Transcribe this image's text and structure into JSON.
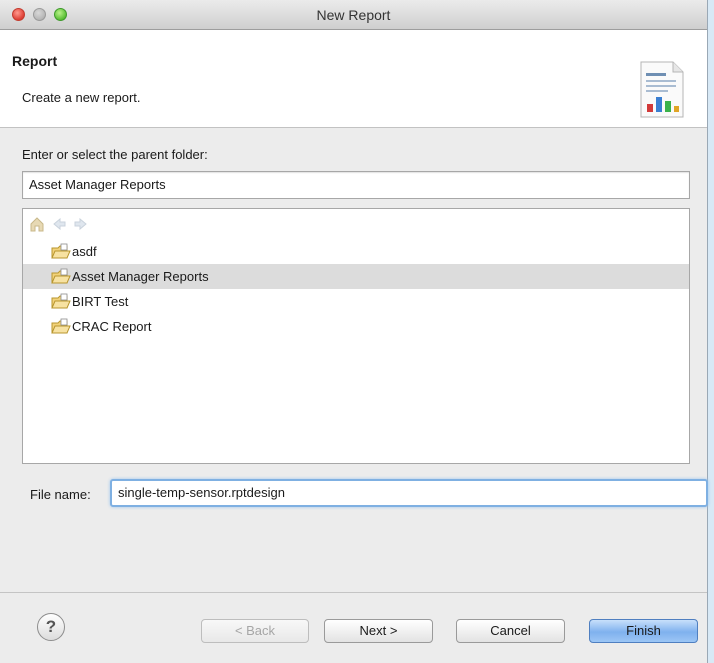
{
  "window": {
    "title": "New Report"
  },
  "header": {
    "title": "Report",
    "description": "Create a new report."
  },
  "folder": {
    "label": "Enter or select the parent folder:",
    "value": "Asset Manager Reports"
  },
  "tree": {
    "items": [
      {
        "label": "asdf",
        "selected": false
      },
      {
        "label": "Asset Manager Reports",
        "selected": true
      },
      {
        "label": "BIRT Test",
        "selected": false
      },
      {
        "label": "CRAC Report",
        "selected": false
      }
    ]
  },
  "file": {
    "label": "File name:",
    "value": "single-temp-sensor.rptdesign"
  },
  "buttons": {
    "help": "?",
    "back": "< Back",
    "next": "Next >",
    "cancel": "Cancel",
    "finish": "Finish"
  },
  "icons": {
    "tree_toolbar": [
      "home-icon",
      "back-arrow-icon",
      "forward-arrow-icon"
    ],
    "folder": "folder-icon",
    "header": "report-wizard-icon"
  },
  "colors": {
    "selection": "#dcdcdc",
    "focus_ring": "#7fb0e2",
    "default_button": "#7fb1ee"
  }
}
